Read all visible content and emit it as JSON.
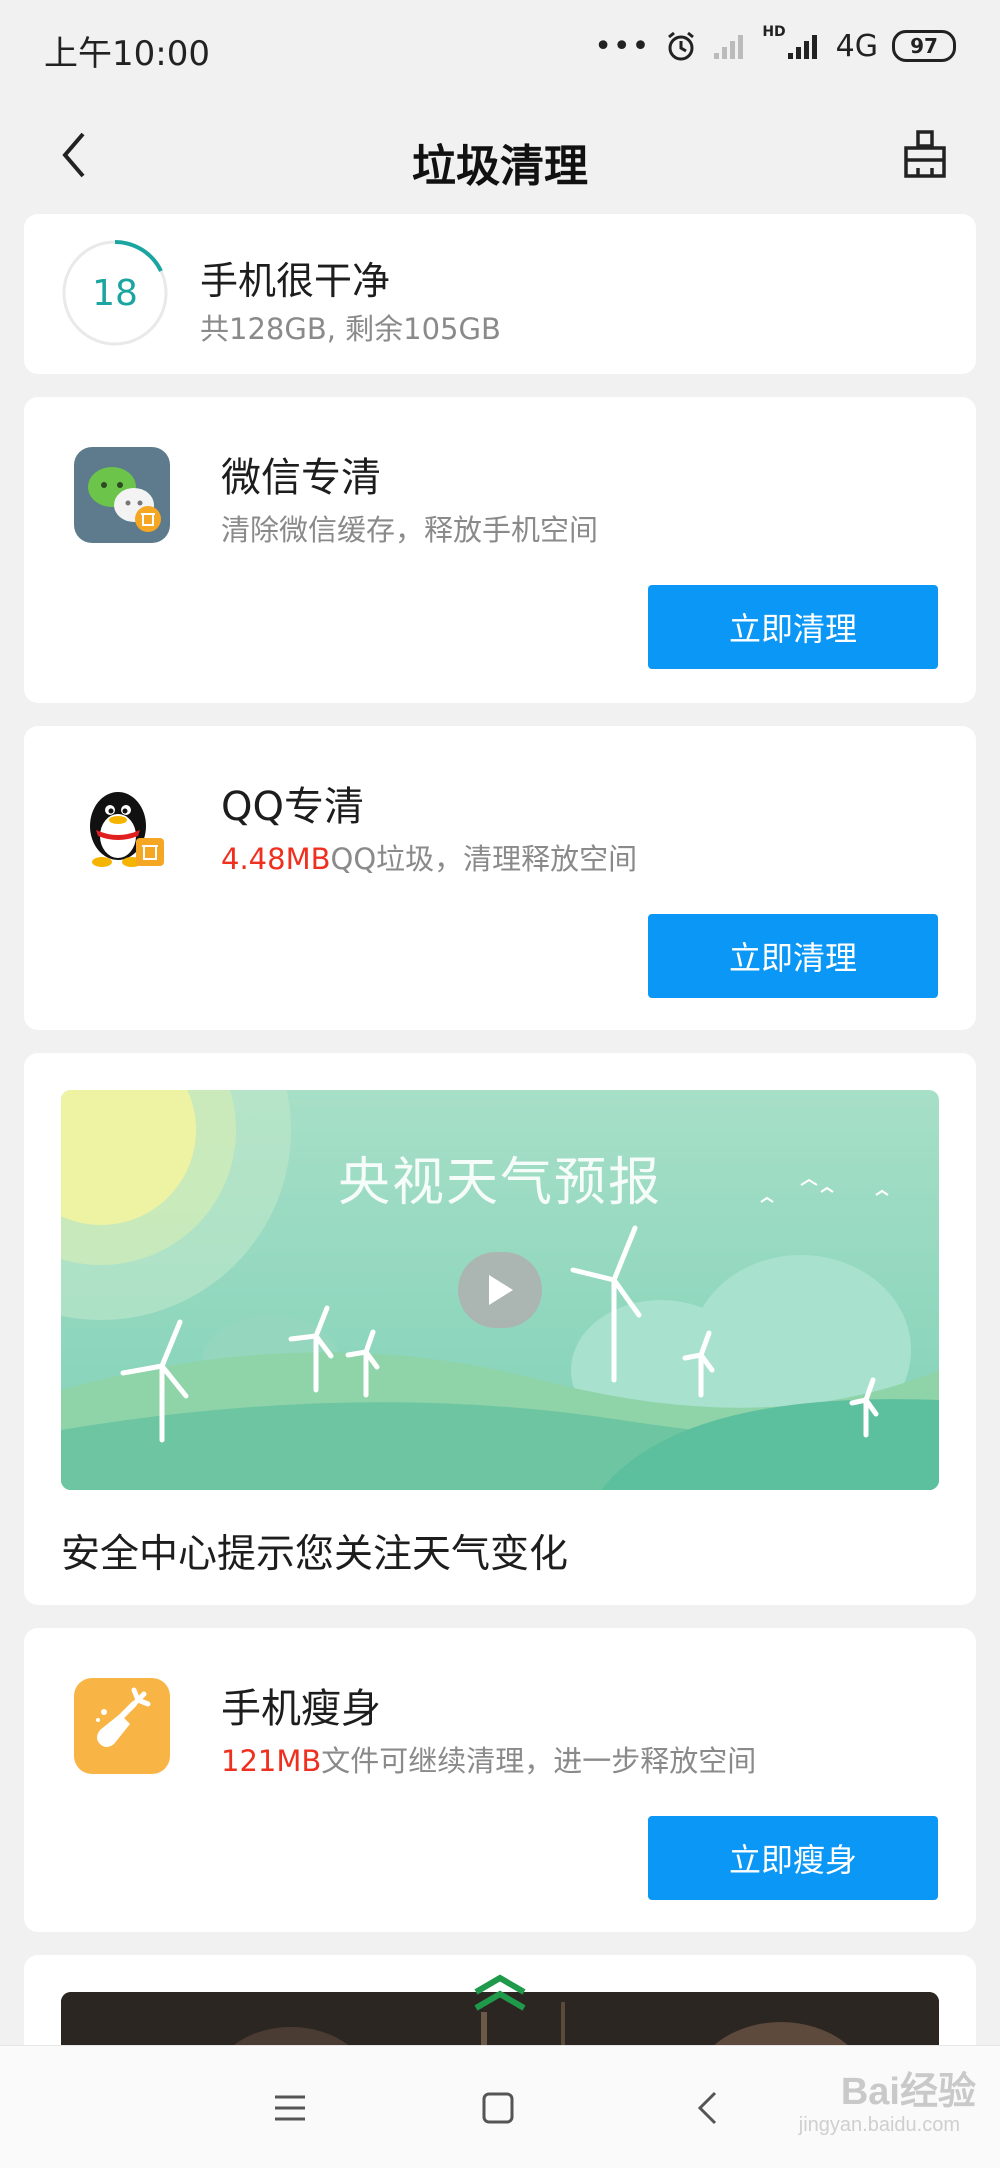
{
  "status_bar": {
    "time": "上午10:00",
    "network": "4G",
    "hd": "HD",
    "battery": "97"
  },
  "header": {
    "title": "垃圾清理"
  },
  "storage_card": {
    "score": "18",
    "status": "手机很干净",
    "detail": "共128GB, 剩余105GB"
  },
  "wechat_card": {
    "title": "微信专清",
    "subtitle": "清除微信缓存，释放手机空间",
    "button": "立即清理"
  },
  "qq_card": {
    "title": "QQ专清",
    "amount": "4.48MB",
    "subtitle_rest": "QQ垃圾，清理释放空间",
    "button": "立即清理"
  },
  "video_card": {
    "video_title": "央视天气预报",
    "caption": "安全中心提示您关注天气变化"
  },
  "slim_card": {
    "title": "手机瘦身",
    "amount": "121MB",
    "subtitle_rest": "文件可继续清理，进一步释放空间",
    "button": "立即瘦身"
  },
  "watermark": {
    "text": "Bai经验",
    "sub": "jingyan.baidu.com"
  },
  "colors": {
    "accent": "#0b97f6",
    "highlight": "#f0301f",
    "ring": "#1ba5a1"
  }
}
